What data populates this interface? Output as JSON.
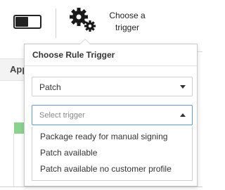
{
  "header": {
    "toggle_state": "off",
    "trigger_button": {
      "label": "Choose a trigger",
      "icon": "gears-icon"
    }
  },
  "background": {
    "column_header": "App"
  },
  "popover": {
    "title": "Choose Rule Trigger",
    "trigger_type_select": {
      "value": "Patch",
      "icon": "caret-down-icon"
    },
    "trigger_select": {
      "placeholder": "Select trigger",
      "icon": "caret-up-icon",
      "state": "open",
      "options": [
        "Package ready for manual signing",
        "Patch available",
        "Patch available no customer profile"
      ]
    }
  },
  "colors": {
    "open_select_border": "#5b9bd5",
    "status_green": "#8bd28f"
  }
}
